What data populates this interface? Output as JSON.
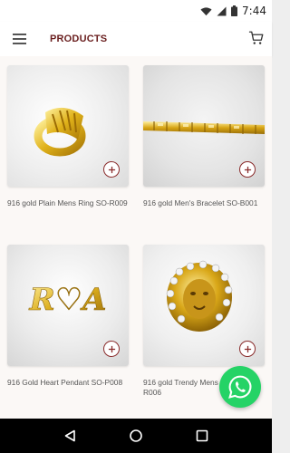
{
  "status_bar": {
    "time": "7:44"
  },
  "app_bar": {
    "title": "PRODUCTS"
  },
  "products": [
    {
      "name": "916 gold Plain Mens Ring SO-R009"
    },
    {
      "name": "916 gold Men's Bracelet SO-B001"
    },
    {
      "name": "916 Gold Heart Pendant SO-P008"
    },
    {
      "name": "916 gold Trendy Mens Ring SO-R006"
    }
  ],
  "pendant_engraving": "R♡A",
  "colors": {
    "accent": "#8a2b2b",
    "title": "#6a1f1f",
    "whatsapp": "#25d366"
  },
  "icons": [
    "wifi-icon",
    "signal-icon",
    "battery-icon",
    "menu-icon",
    "cart-icon",
    "add-icon",
    "back-icon",
    "home-icon",
    "recents-icon",
    "whatsapp-icon"
  ]
}
